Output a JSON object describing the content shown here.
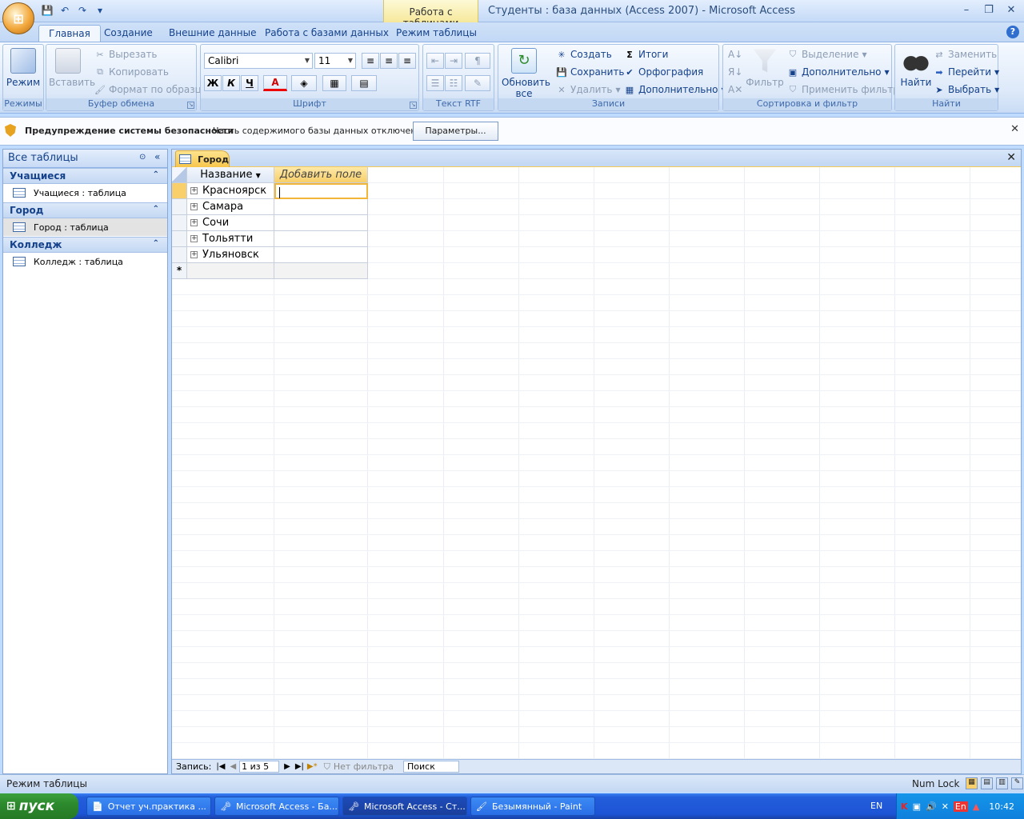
{
  "title_bar": {
    "context_tab": "Работа с таблицами",
    "window_title": "Студенты : база данных (Access 2007) - Microsoft Access",
    "qat": {
      "save_icon": "save-icon",
      "undo_icon": "undo-icon",
      "redo_icon": "redo-icon"
    }
  },
  "ribbon_tabs": [
    "Главная",
    "Создание",
    "Внешние данные",
    "Работа с базами данных",
    "Режим таблицы"
  ],
  "ribbon": {
    "modes": {
      "label": "Режимы",
      "view": "Режим"
    },
    "clipboard": {
      "label": "Буфер обмена",
      "paste": "Вставить",
      "cut": "Вырезать",
      "copy": "Копировать",
      "format_painter": "Формат по образцу"
    },
    "font": {
      "label": "Шрифт",
      "font_name": "Calibri",
      "font_size": "11",
      "bold": "Ж",
      "italic": "К",
      "underline": "Ч",
      "font_color": "A"
    },
    "rtf": {
      "label": "Текст RTF"
    },
    "records": {
      "label": "Записи",
      "refresh": "Обновить",
      "refresh2": "все",
      "new": "Создать",
      "save": "Сохранить",
      "delete": "Удалить",
      "totals": "Итоги",
      "spelling": "Орфография",
      "more": "Дополнительно"
    },
    "sort": {
      "label": "Сортировка и фильтр",
      "filter": "Фильтр",
      "selection": "Выделение",
      "advanced": "Дополнительно",
      "toggle_filter": "Применить фильтр"
    },
    "find": {
      "label": "Найти",
      "find": "Найти",
      "replace": "Заменить",
      "goto": "Перейти",
      "select": "Выбрать"
    }
  },
  "security_bar": {
    "title": "Предупреждение системы безопасности",
    "message": "Часть содержимого базы данных отключено",
    "button": "Параметры..."
  },
  "nav_pane": {
    "header": "Все таблицы",
    "groups": [
      {
        "name": "Учащиеся",
        "item": "Учащиеся : таблица"
      },
      {
        "name": "Город",
        "item": "Город : таблица"
      },
      {
        "name": "Колледж",
        "item": "Колледж : таблица"
      }
    ]
  },
  "document": {
    "tab": "Город",
    "columns": [
      "Название",
      "Добавить поле"
    ],
    "rows": [
      "Красноярск",
      "Самара",
      "Сочи",
      "Тольятти",
      "Ульяновск"
    ],
    "new_row_marker": "*"
  },
  "record_nav": {
    "label": "Запись:",
    "position": "1 из 5",
    "filter": "Нет фильтра",
    "search": "Поиск"
  },
  "status_bar": {
    "mode": "Режим таблицы",
    "numlock": "Num Lock"
  },
  "taskbar": {
    "start": "пуск",
    "tasks": [
      "Отчет уч.практика ...",
      "Microsoft Access - Ба...",
      "Microsoft Access - Ст...",
      "Безымянный - Paint"
    ],
    "lang": "EN",
    "tray_lang": "En",
    "time": "10:42"
  },
  "colors": {
    "accent": "#f7c64b",
    "ribbon_bg": "#dde9f9",
    "taskbar": "#245edb",
    "start": "#2d8a2d"
  }
}
